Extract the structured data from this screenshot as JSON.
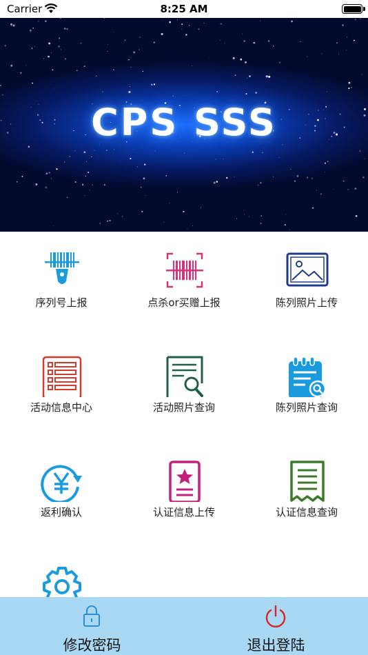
{
  "status_bar": {
    "carrier": "Carrier",
    "time": "8:25 AM"
  },
  "banner": {
    "title": "CPS SSS"
  },
  "menu": [
    {
      "label": "序列号上报",
      "icon": "barcode-scanner-icon",
      "color": "#1a9be0"
    },
    {
      "label": "点杀or买赠上报",
      "icon": "barcode-scan-frame-icon",
      "color": "#d6337a"
    },
    {
      "label": "陈列照片上传",
      "icon": "image-icon",
      "color": "#1f3a8a"
    },
    {
      "label": "活动信息中心",
      "icon": "list-document-icon",
      "color": "#d23a2a"
    },
    {
      "label": "活动照片查询",
      "icon": "document-search-icon",
      "color": "#1f5e4c"
    },
    {
      "label": "陈列照片查询",
      "icon": "calendar-search-icon",
      "color": "#1a9be0"
    },
    {
      "label": "返利确认",
      "icon": "yen-refresh-icon",
      "color": "#1a9be0"
    },
    {
      "label": "认证信息上传",
      "icon": "star-certificate-icon",
      "color": "#c2207a"
    },
    {
      "label": "认证信息查询",
      "icon": "receipt-icon",
      "color": "#3b7a2a"
    },
    {
      "label": "",
      "icon": "gear-icon",
      "color": "#1a9be0"
    }
  ],
  "bottom_bar": {
    "change_password": {
      "label": "修改密码",
      "icon": "lock-icon",
      "color": "#2a8fd8"
    },
    "logout": {
      "label": "退出登陆",
      "icon": "power-icon",
      "color": "#d62a2a"
    }
  }
}
